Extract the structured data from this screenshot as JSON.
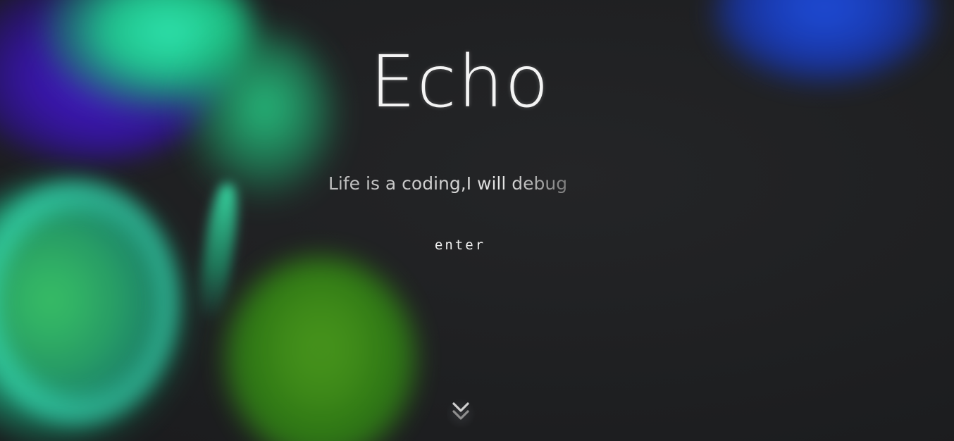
{
  "hero": {
    "title": "Echo",
    "subtitle": "Life is a coding,I will debug",
    "enter_label": "enter"
  },
  "scroll_indicator": {
    "icon": "chevron-double-down-icon"
  },
  "colors": {
    "background": "#1e1f21",
    "text": "#f4f4f4",
    "subtitle": "#c9c9c9",
    "blob_purple": "#4a1bd8",
    "blob_teal": "#2ff0b0",
    "blob_green": "#3bc96a",
    "blob_lime": "#4a9c1c",
    "blob_blue": "#1e4fe0"
  }
}
